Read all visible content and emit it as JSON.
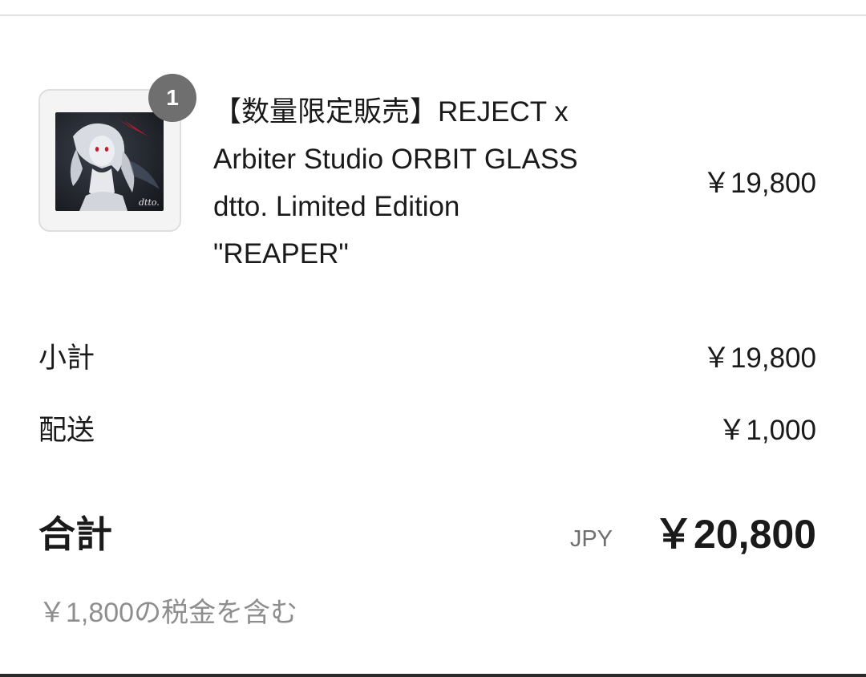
{
  "cart": {
    "item": {
      "quantity": "1",
      "title_lines": [
        "【数量限定販売】REJECT x",
        "Arbiter Studio ORBIT GLASS",
        "dtto. Limited Edition",
        "\"REAPER\""
      ],
      "price": "￥19,800",
      "thumbnail_watermark": "dtto.",
      "thumbnail_icon": "anime-artwork-image"
    }
  },
  "summary": {
    "subtotal_label": "小計",
    "subtotal_value": "￥19,800",
    "shipping_label": "配送",
    "shipping_value": "￥1,000",
    "total_label": "合計",
    "currency_code": "JPY",
    "total_value": "￥20,800",
    "tax_note": "￥1,800の税金を含む"
  },
  "colors": {
    "badge": "#6f6f6f",
    "muted_text": "#8e8e8e",
    "text": "#1a1a1a"
  }
}
